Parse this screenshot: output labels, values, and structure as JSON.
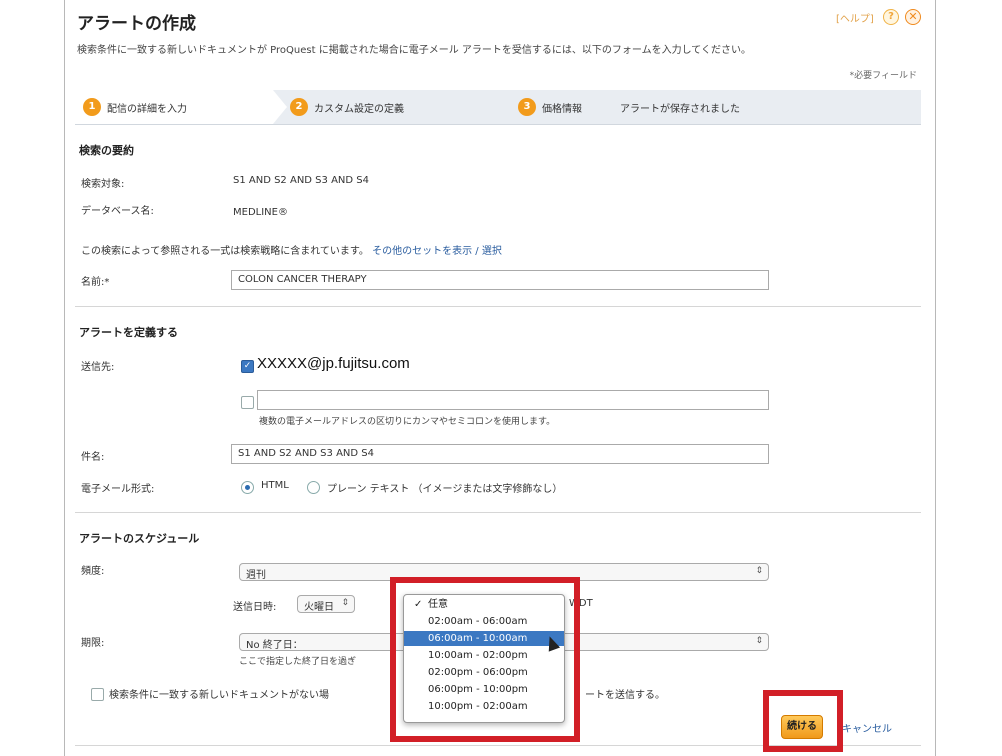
{
  "header": {
    "title": "アラートの作成",
    "help_label": "[ヘルプ]",
    "help_icon_glyph": "?",
    "close_icon_glyph": "✕"
  },
  "intro": {
    "text": "検索条件に一致する新しいドキュメントが ProQuest に掲載された場合に電子メール アラートを受信するには、以下のフォームを入力してください。",
    "required_note": "*必要フィールド"
  },
  "steps": [
    {
      "num": "1",
      "label": "配信の詳細を入力"
    },
    {
      "num": "2",
      "label": "カスタム設定の定義"
    },
    {
      "num": "3",
      "label": "価格情報"
    },
    {
      "num": "",
      "label": "アラートが保存されました"
    }
  ],
  "summary": {
    "heading": "検索の要約",
    "search_target_label": "検索対象:",
    "search_target_value": "S1 AND S2 AND S3 AND S4",
    "database_label": "データベース名:",
    "database_value": "MEDLINE®",
    "note_text": "この検索によって参照される一式は検索戦略に含まれています。",
    "note_link": "その他のセットを表示 / 選択",
    "name_label": "名前:*",
    "name_value": "COLON CANCER THERAPY"
  },
  "define": {
    "heading": "アラートを定義する",
    "sendto_label": "送信先:",
    "email_value": "XXXXX@jp.fujitsu.com",
    "email_extra_value": "",
    "email_hint": "複数の電子メールアドレスの区切りにカンマやセミコロンを使用します。",
    "subject_label": "件名:",
    "subject_value": "S1 AND S2 AND S3 AND S4",
    "format_label": "電子メール形式:",
    "format_html": "HTML",
    "format_text": "プレーン テキスト （イメージまたは文字修飾なし）"
  },
  "schedule": {
    "heading": "アラートのスケジュール",
    "frequency_label": "頻度:",
    "frequency_value": "週刊",
    "send_day_label": "送信日時:",
    "send_day_value": "火曜日",
    "timezone_value": "WDT",
    "period_label": "期限:",
    "period_value": "No 終了日：",
    "period_hint": "ここで指定した終了日を過ぎ",
    "no_match_text": "検索条件に一致する新しいドキュメントがない場",
    "no_match_tail": "ートを送信する。",
    "time_options": [
      "任意",
      "02:00am - 06:00am",
      "06:00am - 10:00am",
      "10:00am - 02:00pm",
      "02:00pm - 06:00pm",
      "06:00pm - 10:00pm",
      "10:00pm - 02:00am"
    ],
    "time_selected_index": 2,
    "checkmark": "✓"
  },
  "actions": {
    "continue_label": "続ける",
    "cancel_label": "キャンセル"
  },
  "colors": {
    "accent_orange": "#f29b1b",
    "highlight_red": "#d21f27",
    "link_blue": "#2a5d9f",
    "select_blue": "#3b78c2"
  }
}
